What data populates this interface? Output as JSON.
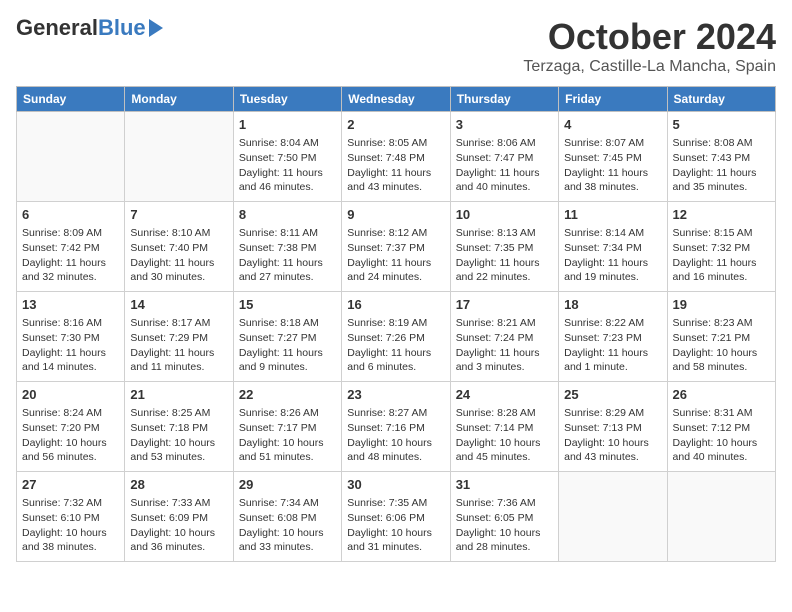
{
  "header": {
    "logo_general": "General",
    "logo_blue": "Blue",
    "month_title": "October 2024",
    "location": "Terzaga, Castille-La Mancha, Spain"
  },
  "days_of_week": [
    "Sunday",
    "Monday",
    "Tuesday",
    "Wednesday",
    "Thursday",
    "Friday",
    "Saturday"
  ],
  "weeks": [
    [
      {
        "day": "",
        "content": ""
      },
      {
        "day": "",
        "content": ""
      },
      {
        "day": "1",
        "content": "Sunrise: 8:04 AM\nSunset: 7:50 PM\nDaylight: 11 hours and 46 minutes."
      },
      {
        "day": "2",
        "content": "Sunrise: 8:05 AM\nSunset: 7:48 PM\nDaylight: 11 hours and 43 minutes."
      },
      {
        "day": "3",
        "content": "Sunrise: 8:06 AM\nSunset: 7:47 PM\nDaylight: 11 hours and 40 minutes."
      },
      {
        "day": "4",
        "content": "Sunrise: 8:07 AM\nSunset: 7:45 PM\nDaylight: 11 hours and 38 minutes."
      },
      {
        "day": "5",
        "content": "Sunrise: 8:08 AM\nSunset: 7:43 PM\nDaylight: 11 hours and 35 minutes."
      }
    ],
    [
      {
        "day": "6",
        "content": "Sunrise: 8:09 AM\nSunset: 7:42 PM\nDaylight: 11 hours and 32 minutes."
      },
      {
        "day": "7",
        "content": "Sunrise: 8:10 AM\nSunset: 7:40 PM\nDaylight: 11 hours and 30 minutes."
      },
      {
        "day": "8",
        "content": "Sunrise: 8:11 AM\nSunset: 7:38 PM\nDaylight: 11 hours and 27 minutes."
      },
      {
        "day": "9",
        "content": "Sunrise: 8:12 AM\nSunset: 7:37 PM\nDaylight: 11 hours and 24 minutes."
      },
      {
        "day": "10",
        "content": "Sunrise: 8:13 AM\nSunset: 7:35 PM\nDaylight: 11 hours and 22 minutes."
      },
      {
        "day": "11",
        "content": "Sunrise: 8:14 AM\nSunset: 7:34 PM\nDaylight: 11 hours and 19 minutes."
      },
      {
        "day": "12",
        "content": "Sunrise: 8:15 AM\nSunset: 7:32 PM\nDaylight: 11 hours and 16 minutes."
      }
    ],
    [
      {
        "day": "13",
        "content": "Sunrise: 8:16 AM\nSunset: 7:30 PM\nDaylight: 11 hours and 14 minutes."
      },
      {
        "day": "14",
        "content": "Sunrise: 8:17 AM\nSunset: 7:29 PM\nDaylight: 11 hours and 11 minutes."
      },
      {
        "day": "15",
        "content": "Sunrise: 8:18 AM\nSunset: 7:27 PM\nDaylight: 11 hours and 9 minutes."
      },
      {
        "day": "16",
        "content": "Sunrise: 8:19 AM\nSunset: 7:26 PM\nDaylight: 11 hours and 6 minutes."
      },
      {
        "day": "17",
        "content": "Sunrise: 8:21 AM\nSunset: 7:24 PM\nDaylight: 11 hours and 3 minutes."
      },
      {
        "day": "18",
        "content": "Sunrise: 8:22 AM\nSunset: 7:23 PM\nDaylight: 11 hours and 1 minute."
      },
      {
        "day": "19",
        "content": "Sunrise: 8:23 AM\nSunset: 7:21 PM\nDaylight: 10 hours and 58 minutes."
      }
    ],
    [
      {
        "day": "20",
        "content": "Sunrise: 8:24 AM\nSunset: 7:20 PM\nDaylight: 10 hours and 56 minutes."
      },
      {
        "day": "21",
        "content": "Sunrise: 8:25 AM\nSunset: 7:18 PM\nDaylight: 10 hours and 53 minutes."
      },
      {
        "day": "22",
        "content": "Sunrise: 8:26 AM\nSunset: 7:17 PM\nDaylight: 10 hours and 51 minutes."
      },
      {
        "day": "23",
        "content": "Sunrise: 8:27 AM\nSunset: 7:16 PM\nDaylight: 10 hours and 48 minutes."
      },
      {
        "day": "24",
        "content": "Sunrise: 8:28 AM\nSunset: 7:14 PM\nDaylight: 10 hours and 45 minutes."
      },
      {
        "day": "25",
        "content": "Sunrise: 8:29 AM\nSunset: 7:13 PM\nDaylight: 10 hours and 43 minutes."
      },
      {
        "day": "26",
        "content": "Sunrise: 8:31 AM\nSunset: 7:12 PM\nDaylight: 10 hours and 40 minutes."
      }
    ],
    [
      {
        "day": "27",
        "content": "Sunrise: 7:32 AM\nSunset: 6:10 PM\nDaylight: 10 hours and 38 minutes."
      },
      {
        "day": "28",
        "content": "Sunrise: 7:33 AM\nSunset: 6:09 PM\nDaylight: 10 hours and 36 minutes."
      },
      {
        "day": "29",
        "content": "Sunrise: 7:34 AM\nSunset: 6:08 PM\nDaylight: 10 hours and 33 minutes."
      },
      {
        "day": "30",
        "content": "Sunrise: 7:35 AM\nSunset: 6:06 PM\nDaylight: 10 hours and 31 minutes."
      },
      {
        "day": "31",
        "content": "Sunrise: 7:36 AM\nSunset: 6:05 PM\nDaylight: 10 hours and 28 minutes."
      },
      {
        "day": "",
        "content": ""
      },
      {
        "day": "",
        "content": ""
      }
    ]
  ]
}
